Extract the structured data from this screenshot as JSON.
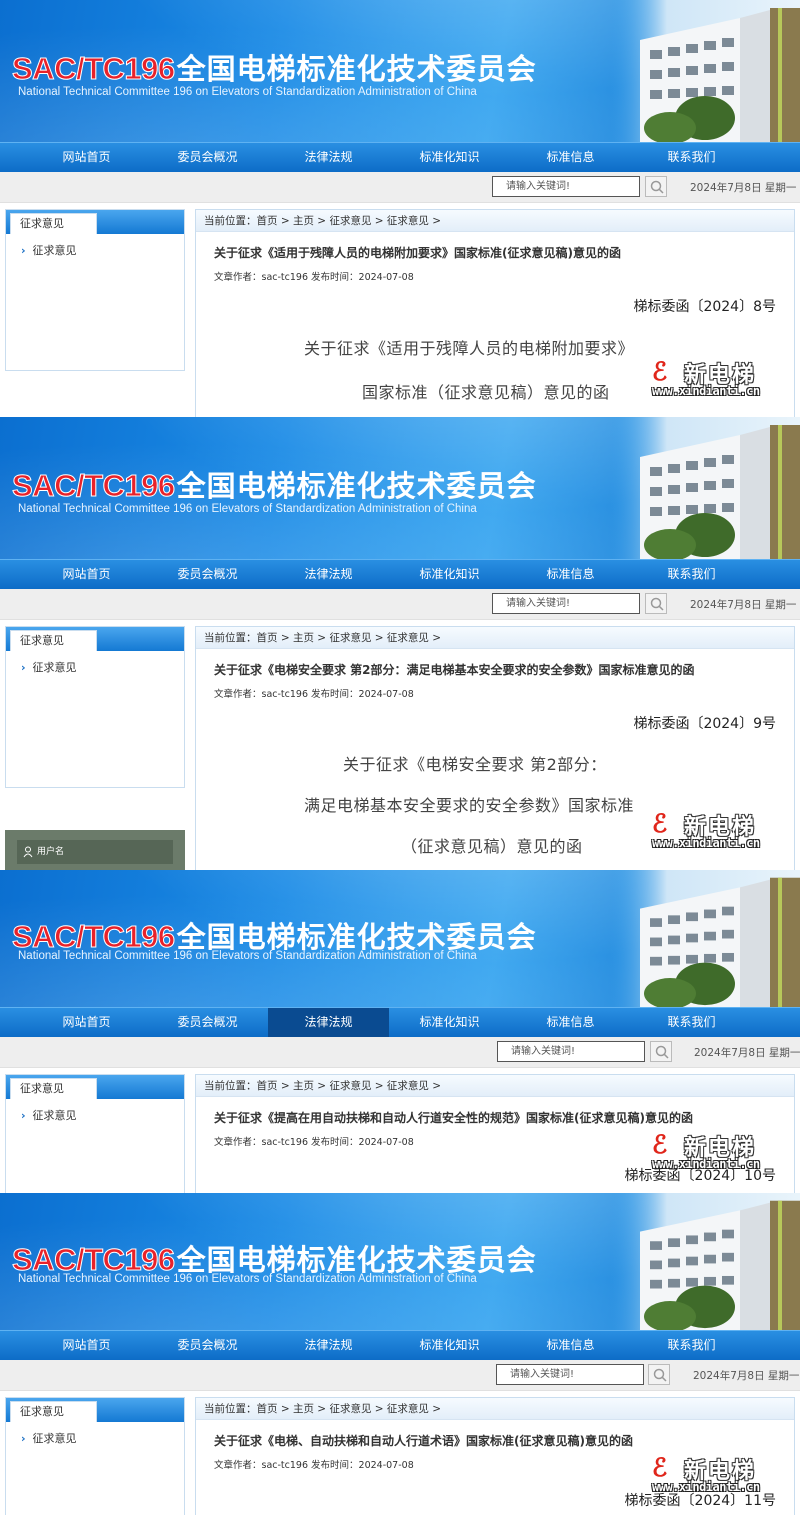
{
  "site": {
    "code": "SAC/TC196",
    "name": "全国电梯标准化技术委员会",
    "subtitle": "National Technical Committee 196 on Elevators of Standardization Administration of China"
  },
  "nav": [
    "网站首页",
    "委员会概况",
    "法律法规",
    "标准化知识",
    "标准信息",
    "联系我们"
  ],
  "search": {
    "placeholder": "请输入关键词!"
  },
  "date": "2024年7月8日 星期一",
  "sidebar": {
    "tab": "征求意见",
    "item": "征求意见"
  },
  "login": {
    "username_label": "用户名"
  },
  "watermark": {
    "logo": "ℰ",
    "name": "新电梯",
    "url": "www.xindianti.cn"
  },
  "screens": [
    {
      "breadcrumb": "当前位置：首页 > 主页 > 征求意见 > 征求意见 >",
      "title": "关于征求《适用于残障人员的电梯附加要求》国家标准(征求意见稿)意见的函",
      "meta": "文章作者：sac-tc196 发布时间：2024-07-08",
      "letter_no": "梯标委函〔2024〕8号",
      "body": [
        "关于征求《适用于残障人员的电梯附加要求》",
        "国家标准（征求意见稿）意见的函"
      ]
    },
    {
      "breadcrumb": "当前位置：首页 > 主页 > 征求意见 > 征求意见 >",
      "title": "关于征求《电梯安全要求 第2部分：满足电梯基本安全要求的安全参数》国家标准意见的函",
      "meta": "文章作者：sac-tc196 发布时间：2024-07-08",
      "letter_no": "梯标委函〔2024〕9号",
      "body": [
        "关于征求《电梯安全要求  第2部分：",
        "满足电梯基本安全要求的安全参数》国家标准",
        "（征求意见稿）意见的函"
      ]
    },
    {
      "breadcrumb": "当前位置：首页 > 主页 > 征求意见 > 征求意见 >",
      "title": "关于征求《提高在用自动扶梯和自动人行道安全性的规范》国家标准(征求意见稿)意见的函",
      "meta": "文章作者：sac-tc196 发布时间：2024-07-08",
      "letter_no": "梯标委函〔2024〕10号",
      "body": []
    },
    {
      "breadcrumb": "当前位置：首页 > 主页 > 征求意见 > 征求意见 >",
      "title": "关于征求《电梯、自动扶梯和自动人行道术语》国家标准(征求意见稿)意见的函",
      "meta": "文章作者：sac-tc196 发布时间：2024-07-08",
      "letter_no": "梯标委函〔2024〕11号",
      "body": []
    }
  ]
}
